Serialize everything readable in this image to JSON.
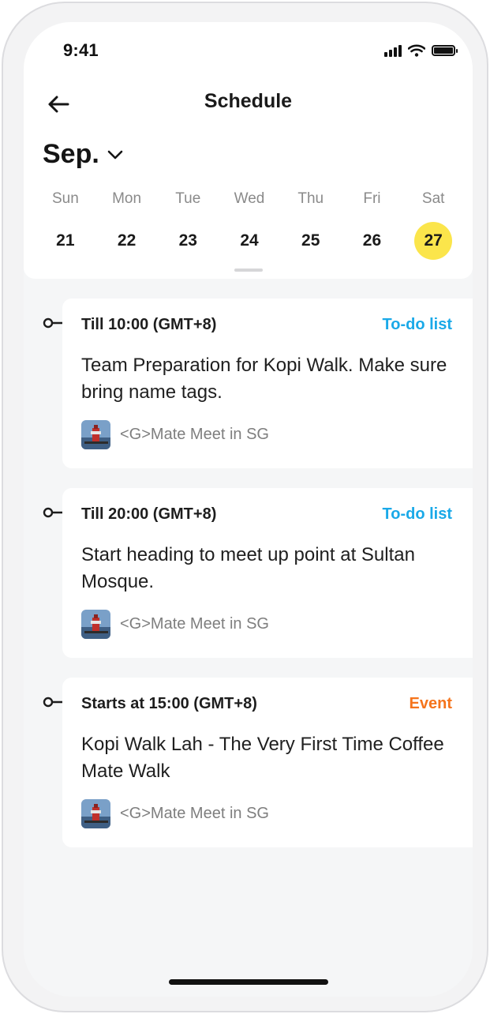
{
  "status_bar": {
    "time": "9:41"
  },
  "header": {
    "title": "Schedule",
    "back_icon": "arrow-left-icon"
  },
  "calendar": {
    "month": "Sep.",
    "days": [
      {
        "name": "Sun",
        "date": "21"
      },
      {
        "name": "Mon",
        "date": "22"
      },
      {
        "name": "Tue",
        "date": "23"
      },
      {
        "name": "Wed",
        "date": "24"
      },
      {
        "name": "Thu",
        "date": "25"
      },
      {
        "name": "Fri",
        "date": "26"
      },
      {
        "name": "Sat",
        "date": "27"
      }
    ],
    "selected_date": "27",
    "selected_color": "#fbe54b"
  },
  "schedule": [
    {
      "time": "Till 10:00 (GMT+8)",
      "type": "To-do list",
      "description": "Team Preparation for Kopi Walk. Make sure bring name tags.",
      "group": "<G>Mate Meet in SG"
    },
    {
      "time": "Till 20:00 (GMT+8)",
      "type": "To-do list",
      "description": "Start heading to meet up point at Sultan Mosque.",
      "group": "<G>Mate Meet in SG"
    },
    {
      "time": "Starts at 15:00 (GMT+8)",
      "type": "Event",
      "description": "Kopi Walk Lah - The Very First Time Coffee Mate Walk",
      "group": "<G>Mate Meet in SG"
    }
  ],
  "colors": {
    "todo": "#1aa9e8",
    "event": "#f5741c"
  }
}
